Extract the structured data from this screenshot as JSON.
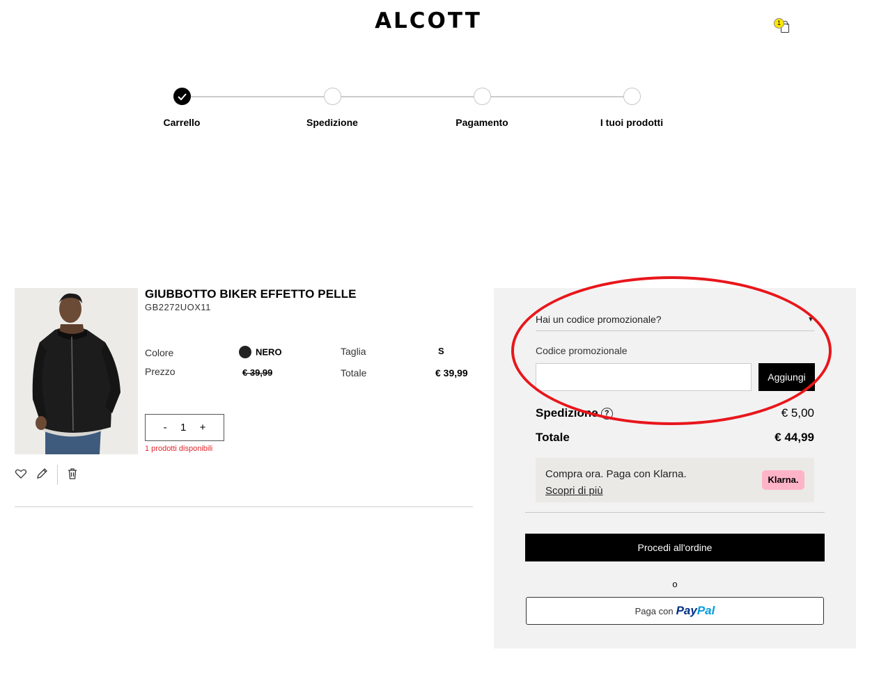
{
  "header": {
    "logo_text": "ALCOTT",
    "cart_count": "1",
    "cart_icon": "shopping-bag-icon"
  },
  "stepper": {
    "steps": [
      {
        "label": "Carrello",
        "state": "done"
      },
      {
        "label": "Spedizione",
        "state": "todo"
      },
      {
        "label": "Pagamento",
        "state": "todo"
      },
      {
        "label": "I tuoi prodotti",
        "state": "todo"
      }
    ]
  },
  "product": {
    "title": "GIUBBOTTO BIKER EFFETTO PELLE",
    "code": "GB2272UOX11",
    "color_label": "Colore",
    "color_value": "NERO",
    "color_hex": "#222222",
    "size_label": "Taglia",
    "size_value": "S",
    "price_label": "Prezzo",
    "price_value": "€ 39,99",
    "total_label": "Totale",
    "total_value": "€ 39,99",
    "qty_minus": "-",
    "qty_value": "1",
    "qty_plus": "+",
    "availability": "1 prodotti disponibili",
    "actions": [
      "heart-icon",
      "pencil-icon",
      "trash-icon"
    ]
  },
  "summary": {
    "promo_toggle": "Hai un codice promozionale?",
    "promo_label": "Codice promozionale",
    "promo_value": "",
    "promo_button": "Aggiungi",
    "shipping_label": "Spedizione",
    "shipping_help": "?",
    "shipping_value": "€ 5,00",
    "total_label": "Totale",
    "total_value": "€ 44,99",
    "klarna_text": "Compra ora. Paga con Klarna.",
    "klarna_link": "Scopri di più",
    "klarna_badge": "Klarna.",
    "order_button": "Procedi all'ordine",
    "or_text": "o",
    "paypal_prefix": "Paga con",
    "paypal_logo_a": "Pay",
    "paypal_logo_b": "Pal"
  },
  "colors": {
    "accent": "#000000",
    "error": "#e3262d",
    "annotation": "#e8161b",
    "klarna_pink": "#ffb3c7",
    "cart_badge": "#ffe600"
  }
}
